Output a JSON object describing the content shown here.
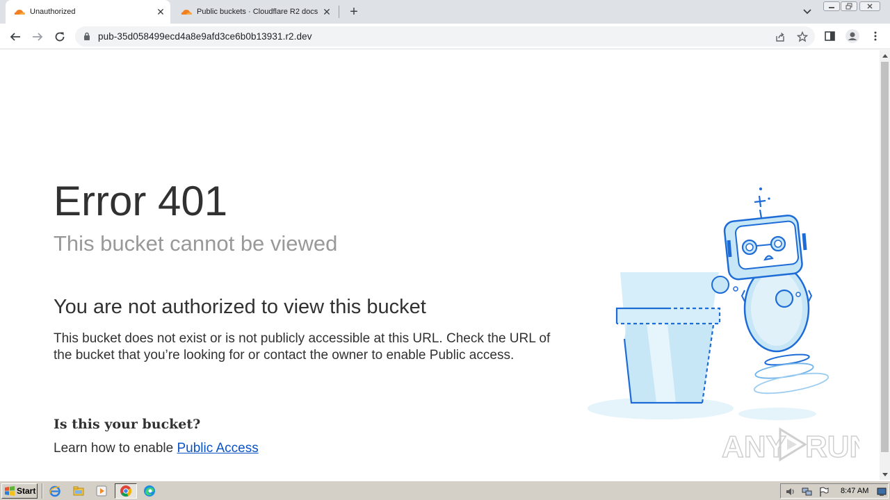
{
  "browser": {
    "tabs": [
      {
        "title": "Unauthorized",
        "favicon": "cloudflare-icon",
        "active": true
      },
      {
        "title": "Public buckets · Cloudflare R2 docs",
        "favicon": "cloudflare-icon",
        "active": false
      }
    ],
    "new_tab_symbol": "+",
    "close_symbol": "✕",
    "url": "pub-35d058499ecd4a8e9afd3ce6b0b13931.r2.dev"
  },
  "page": {
    "error_code": "Error 401",
    "error_subtitle": "This bucket cannot be viewed",
    "heading": "You are not authorized to view this bucket",
    "paragraph": "This bucket does not exist or is not publicly accessible at this URL. Check the URL of the bucket that you’re looking for or contact the owner to enable Public access.",
    "question": "Is this your bucket?",
    "learn_prefix": "Learn how to enable ",
    "learn_link": "Public Access"
  },
  "watermark": {
    "text_left": "ANY",
    "text_right": "RUN"
  },
  "taskbar": {
    "start_label": "Start",
    "clock": "8:47 AM"
  },
  "colors": {
    "accent_link": "#0b52c4",
    "illustration_blue": "#1d6bd6",
    "illustration_light": "#c7e6f6",
    "cloudflare_orange": "#f38020"
  }
}
